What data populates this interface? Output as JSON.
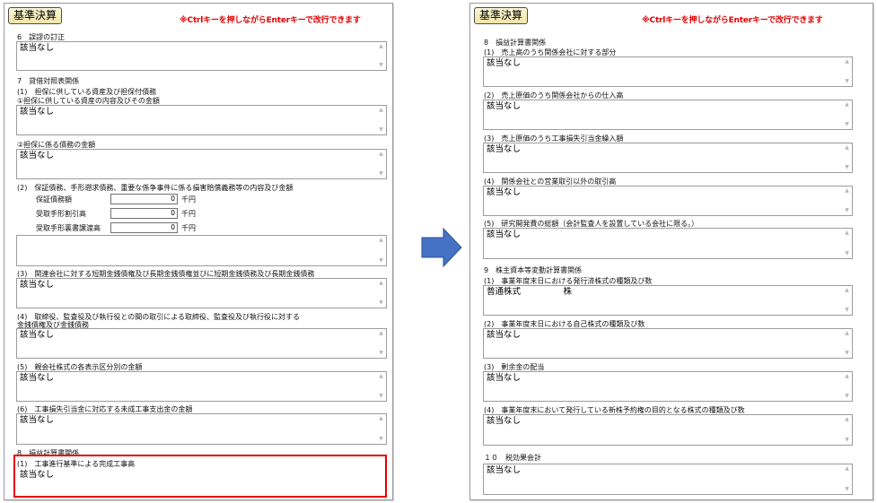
{
  "left_panel": {
    "title": "基準決算",
    "notice": "※Ctrlキーを押しながらEnterキーで改行できます",
    "labels": {
      "s6": "6　誤謬の訂正",
      "s7": "7　貸借対照表関係",
      "s7_1": "(1)　担保に供している資産及び担保付債務",
      "s7_1a": "①担保に供している資産の内容及びその金額",
      "s7_1b": "②担保に係る債務の金額",
      "s7_2": "(2)　保証債務、手形遡求債務、重要な係争事件に係る損害賠償義務等の内容及び金額",
      "guarantee": "保証債務額",
      "notes_discounted": "受取手形割引高",
      "notes_endorsed": "受取手形裏書譲渡高",
      "s7_3": "(3)　関連会社に対する短期金銭債権及び長期金銭債権並びに短期金銭債務及び長期金銭債務",
      "s7_4_line1": "(4)　取締役、監査役及び執行役との間の取引による取締役、監査役及び執行役に対する",
      "s7_4_line2": "金銭債権及び金銭債務",
      "s7_5": "(5)　親会社株式の各表示区分別の金額",
      "s7_6": "(6)　工事損失引当金に対応する未成工事支出金の金額",
      "s8": "8　損益計算書関係",
      "s8_1": "(1)　工事進行基準による完成工事高"
    },
    "values": {
      "s6": "該当なし",
      "s7_1a": "該当なし",
      "s7_1b": "該当なし",
      "guarantee": "0",
      "notes_discounted": "0",
      "notes_endorsed": "0",
      "yen_unit": "千円",
      "s7_2_text": "",
      "s7_3": "該当なし",
      "s7_4": "該当なし",
      "s7_5": "該当なし",
      "s7_6": "該当なし",
      "s8_1": "該当なし"
    }
  },
  "right_panel": {
    "title": "基準決算",
    "notice": "※Ctrlキーを押しながらEnterキーで改行できます",
    "labels": {
      "s8": "8　損益計算書関係",
      "s8_1": "(1)　売上高のうち関係会社に対する部分",
      "s8_2": "(2)　売上原価のうち関係会社からの仕入高",
      "s8_3": "(3)　売上原価のうち工事損失引当金繰入額",
      "s8_4": "(4)　関係会社との営業取引以外の取引高",
      "s8_5": "(5)　研究開発費の総額（会計監査人を設置している会社に限る。）",
      "s9": "9　株主資本等変動計算書関係",
      "s9_1": "(1)　事業年度末日における発行済株式の種類及び数",
      "s9_2": "(2)　事業年度末日における自己株式の種類及び数",
      "s9_3": "(3)　剰余金の配当",
      "s9_4": "(4)　事業年度末において発行している新株予約権の目的となる株式の種類及び数",
      "s10": "１０　税効果会計"
    },
    "values": {
      "s8_1": "該当なし",
      "s8_2": "該当なし",
      "s8_3": "該当なし",
      "s8_4": "該当なし",
      "s8_5": "該当なし",
      "s9_1": "普通株式　　　　　株",
      "s9_2": "該当なし",
      "s9_3": "該当なし",
      "s9_4": "該当なし",
      "s10": "該当なし"
    }
  },
  "colors": {
    "notice": "#e00000",
    "highlight": "#e30000",
    "arrow": "#4472c4",
    "badge": "#f3ecb8"
  },
  "icons": {
    "arrow": "right-arrow-icon",
    "scroll_up": "scroll-up-icon",
    "scroll_down": "scroll-down-icon"
  }
}
